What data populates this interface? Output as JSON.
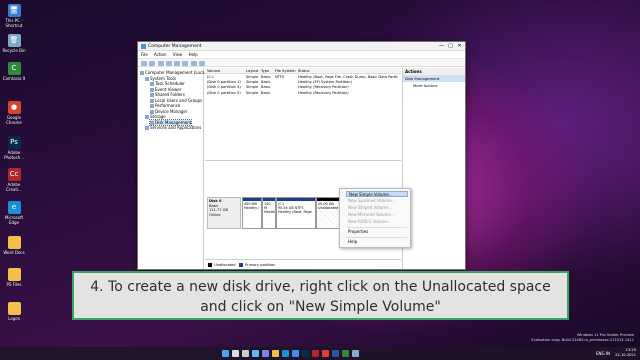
{
  "desktop": {
    "icons": [
      {
        "label": "This PC - Shortcut",
        "icon": "this-pc-icon",
        "glyph": "🖥",
        "color": "#3b7bd4"
      },
      {
        "label": "Recycle Bin",
        "icon": "recycle-bin-icon",
        "glyph": "🗑",
        "color": "#7da7c9"
      },
      {
        "label": "Camtasia 9",
        "icon": "camtasia-icon",
        "glyph": "C",
        "color": "#2e8b3e"
      },
      {
        "label": "Google Chrome",
        "icon": "chrome-icon",
        "glyph": "●",
        "color": "#d9442e"
      },
      {
        "label": "Adobe Photosh...",
        "icon": "photoshop-icon",
        "glyph": "Ps",
        "color": "#0a2a4d"
      },
      {
        "label": "Adobe Creati...",
        "icon": "adobe-cc-icon",
        "glyph": "Cc",
        "color": "#b1252b"
      },
      {
        "label": "Microsoft Edge",
        "icon": "edge-icon",
        "glyph": "e",
        "color": "#1a8fd8"
      },
      {
        "label": "Word Docs",
        "icon": "folder-icon",
        "glyph": "",
        "color": "#f2c04a"
      },
      {
        "label": "PS Files",
        "icon": "folder-icon",
        "glyph": "",
        "color": "#f2c04a"
      },
      {
        "label": "Logos",
        "icon": "folder-icon",
        "glyph": "",
        "color": "#f2c04a"
      }
    ]
  },
  "window": {
    "title": "Computer Management",
    "controls": [
      "—",
      "□",
      "✕"
    ],
    "menu": [
      "File",
      "Action",
      "View",
      "Help"
    ],
    "tree": [
      {
        "label": "Computer Management (Local",
        "level": 0
      },
      {
        "label": "System Tools",
        "level": 1
      },
      {
        "label": "Task Scheduler",
        "level": 2
      },
      {
        "label": "Event Viewer",
        "level": 2
      },
      {
        "label": "Shared Folders",
        "level": 2
      },
      {
        "label": "Local Users and Groups",
        "level": 2
      },
      {
        "label": "Performance",
        "level": 2
      },
      {
        "label": "Device Manager",
        "level": 2
      },
      {
        "label": "Storage",
        "level": 1
      },
      {
        "label": "Disk Management",
        "level": 2,
        "selected": true
      },
      {
        "label": "Services and Applications",
        "level": 1
      }
    ],
    "volume_table": {
      "headers": [
        "Volume",
        "Layout",
        "Type",
        "File System",
        "Status"
      ],
      "rows": [
        [
          "(C:)",
          "Simple",
          "Basic",
          "NTFS",
          "Healthy (Boot, Page File, Crash Dump, Basic Data Partition)"
        ],
        [
          "(Disk 0 partition 1)",
          "Simple",
          "Basic",
          "",
          "Healthy (EFI System Partition)"
        ],
        [
          "(Disk 0 partition 4)",
          "Simple",
          "Basic",
          "",
          "Healthy (Recovery Partition)"
        ],
        [
          "(Disk 0 partition 5)",
          "Simple",
          "Basic",
          "",
          "Healthy (Recovery Partition)"
        ]
      ]
    },
    "disk": {
      "name": "Disk 0",
      "type": "Basic",
      "size": "111.77 GB",
      "status": "Online",
      "partitions": [
        {
          "line1": "450 MB",
          "line2": "Healthy (",
          "unallocated": false
        },
        {
          "line1": "100 M",
          "line2": "Health",
          "unallocated": false
        },
        {
          "line1": "(C:)",
          "line2": "90.54 GB NTFS",
          "line3": "Healthy (Boot, Page",
          "unallocated": false
        },
        {
          "line1": "20.00 GB",
          "line2": "Unallocated",
          "unallocated": true
        }
      ]
    },
    "legend": [
      {
        "label": "Unallocated",
        "color": "#000000"
      },
      {
        "label": "Primary partition",
        "color": "#1c3c8c"
      }
    ],
    "actions": {
      "header": "Actions",
      "section": "Disk Management",
      "items": [
        "More Actions"
      ]
    },
    "context_menu": [
      {
        "label": "New Simple Volume...",
        "state": "highlighted"
      },
      {
        "label": "New Spanned Volume...",
        "state": "disabled"
      },
      {
        "label": "New Striped Volume...",
        "state": "disabled"
      },
      {
        "label": "New Mirrored Volume...",
        "state": "disabled"
      },
      {
        "label": "New RAID-5 Volume...",
        "state": "disabled"
      },
      {
        "label": "Properties",
        "state": "normal"
      },
      {
        "label": "Help",
        "state": "normal"
      }
    ]
  },
  "caption": {
    "line1": "4. To create a new disk drive, right click on the Unallocated space",
    "line2": "and click on \"New Simple Volume\""
  },
  "watermark": {
    "line1": "Windows 11 Pro Insider Preview",
    "line2": "Evaluation copy. Build 22483.rs_prerelease.211015-1411"
  },
  "taskbar": {
    "time": "13:29",
    "date": "22-10-2021",
    "lang": "ENG IN",
    "apps": [
      {
        "icon": "start-icon",
        "color": "#4aa3f0"
      },
      {
        "icon": "search-icon",
        "color": "#dddddd"
      },
      {
        "icon": "task-view-icon",
        "color": "#cccccc"
      },
      {
        "icon": "widgets-icon",
        "color": "#5bb6ff"
      },
      {
        "icon": "chat-icon",
        "color": "#7b83eb"
      },
      {
        "icon": "file-explorer-icon",
        "color": "#f2c04a"
      },
      {
        "icon": "edge-icon",
        "color": "#1a8fd8"
      },
      {
        "icon": "store-icon",
        "color": "#3d8ee6"
      },
      {
        "icon": "photoshop-icon",
        "color": "#0a2a4d"
      },
      {
        "icon": "adobe-icon",
        "color": "#b1252b"
      },
      {
        "icon": "chrome-icon",
        "color": "#d9442e"
      },
      {
        "icon": "word-icon",
        "color": "#2b579a"
      },
      {
        "icon": "camtasia-icon",
        "color": "#2e8b3e"
      },
      {
        "icon": "computer-management-icon",
        "color": "#8aa7d1"
      }
    ]
  }
}
